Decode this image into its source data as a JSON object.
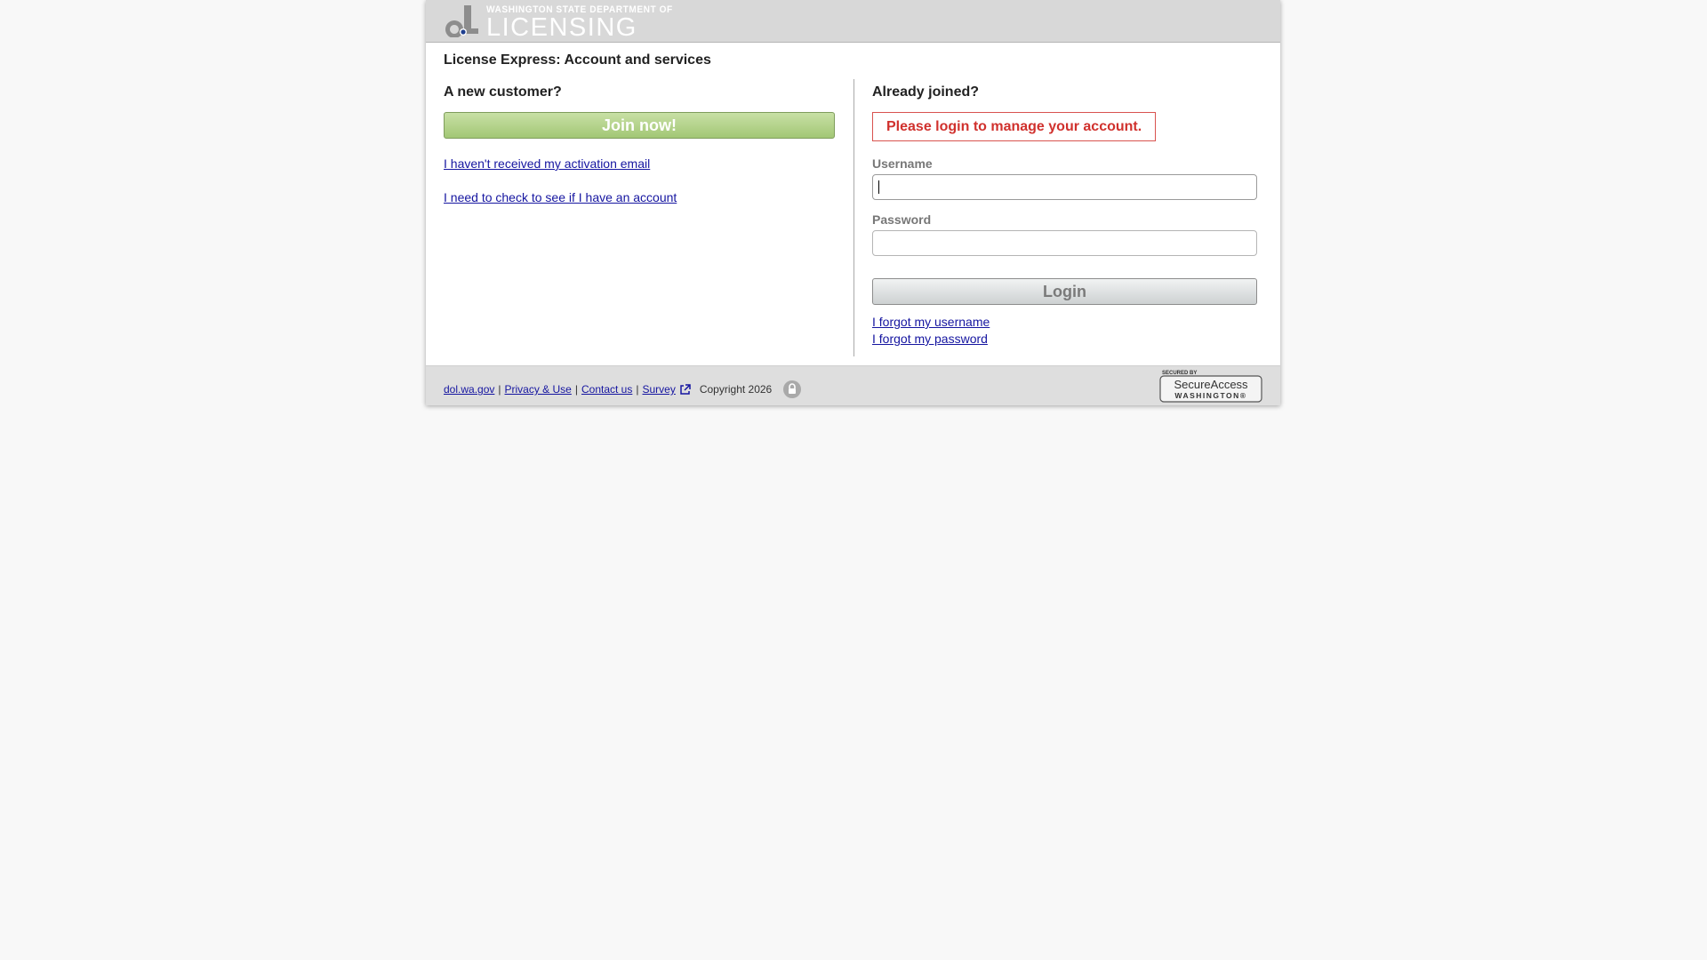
{
  "header": {
    "logo_top": "WASHINGTON STATE DEPARTMENT OF",
    "logo_main": "LICENSING"
  },
  "page_title": "License Express: Account and services",
  "left": {
    "heading": "A new customer?",
    "join_label": "Join now!",
    "link_activation": "I haven't received my activation email",
    "link_check": "I need to check to see if I have an account"
  },
  "right": {
    "heading": "Already joined?",
    "alert": "Please login to manage your account.",
    "username_label": "Username",
    "username_value": "",
    "password_label": "Password",
    "password_value": "",
    "login_label": "Login",
    "forgot_username": "I forgot my username",
    "forgot_password": "I forgot my password"
  },
  "footer": {
    "link_dol": "dol.wa.gov",
    "link_privacy": "Privacy & Use",
    "link_contact": "Contact us",
    "link_survey": "Survey",
    "separator": "|",
    "copyright": "Copyright 2026",
    "badge_top": "SECURED BY",
    "badge_main": "SecureAccess",
    "badge_sub": "WASHINGTON®"
  },
  "colors": {
    "page_bg": "#f8f8f8",
    "header_bg": "#d8d8d8",
    "join_green": "#a2c775",
    "alert_red": "#d0312d",
    "link_blue": "#1515a0"
  },
  "icons": [
    "dol-logo-icon",
    "external-link-icon",
    "lock-icon",
    "secure-access-washington-badge"
  ]
}
